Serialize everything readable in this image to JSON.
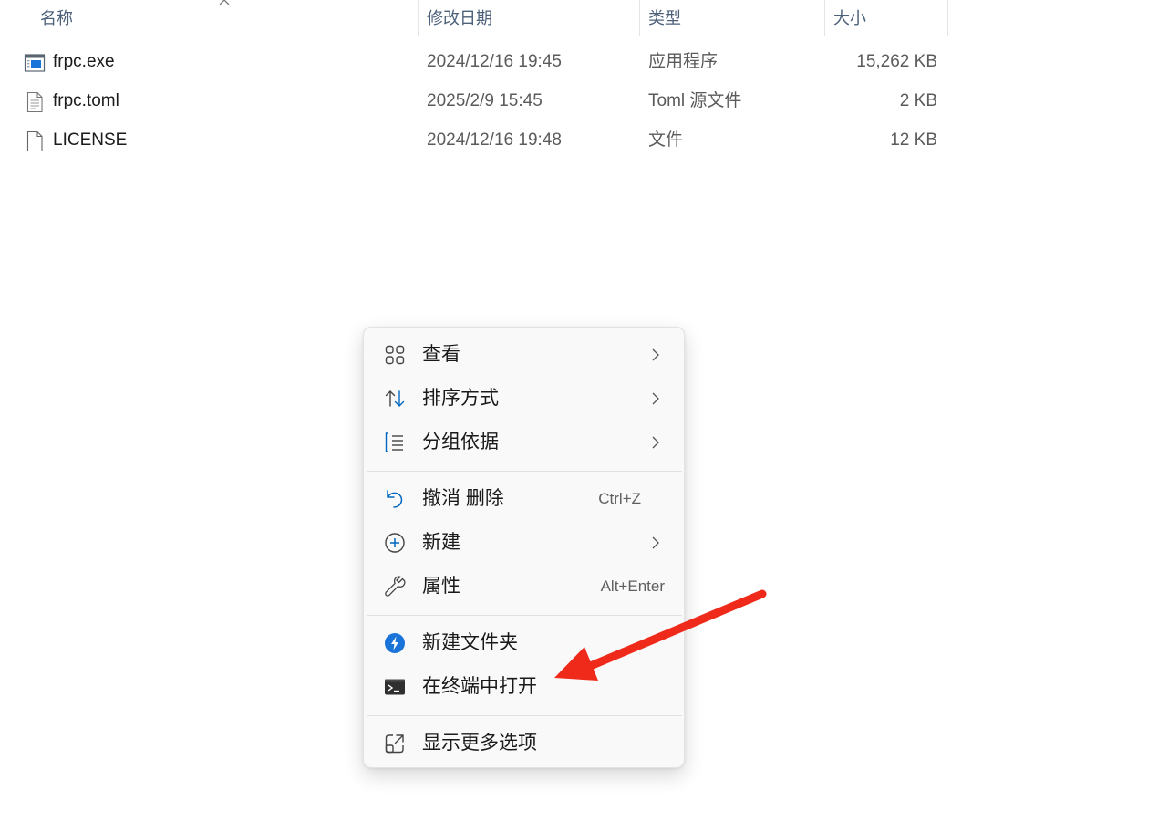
{
  "columns": {
    "name": "名称",
    "modified": "修改日期",
    "type": "类型",
    "size": "大小"
  },
  "files": [
    {
      "name": "frpc.exe",
      "modified": "2024/12/16 19:45",
      "type": "应用程序",
      "size": "15,262 KB",
      "icon": "exe-file-icon"
    },
    {
      "name": "frpc.toml",
      "modified": "2025/2/9 15:45",
      "type": "Toml 源文件",
      "size": "2 KB",
      "icon": "text-file-icon"
    },
    {
      "name": "LICENSE",
      "modified": "2024/12/16 19:48",
      "type": "文件",
      "size": "12 KB",
      "icon": "blank-file-icon"
    }
  ],
  "menu": {
    "view": "查看",
    "sort": "排序方式",
    "group": "分组依据",
    "undo": "撤消 删除",
    "undo_shortcut": "Ctrl+Z",
    "new": "新建",
    "properties": "属性",
    "properties_shortcut": "Alt+Enter",
    "new_folder": "新建文件夹",
    "open_terminal": "在终端中打开",
    "more_options": "显示更多选项"
  },
  "colors": {
    "header_text": "#4c607a",
    "accent": "#0067c0",
    "annotation_arrow": "#f02a1a"
  }
}
